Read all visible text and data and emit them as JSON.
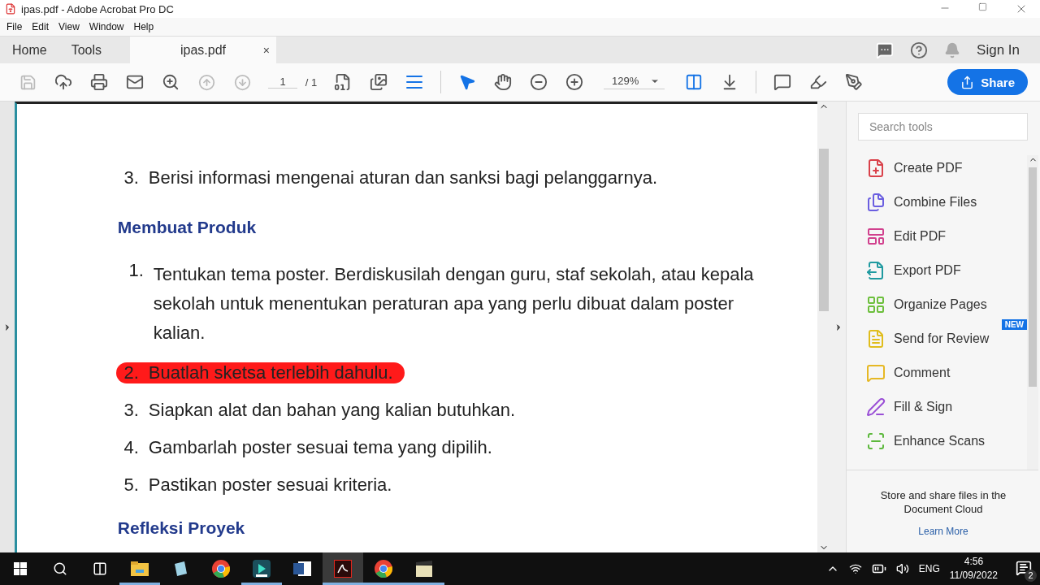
{
  "window": {
    "title": "ipas.pdf - Adobe Acrobat Pro DC"
  },
  "menu": [
    "File",
    "Edit",
    "View",
    "Window",
    "Help"
  ],
  "tabs": [
    {
      "label": "Home",
      "selected": false
    },
    {
      "label": "Tools",
      "selected": false
    },
    {
      "label": "ipas.pdf",
      "selected": true,
      "close": "×"
    }
  ],
  "account": {
    "label": "Sign In"
  },
  "toolbar": {
    "page": "1",
    "page_total": "/ 1",
    "zoom": "129%",
    "share": "Share"
  },
  "document": {
    "lines": [
      {
        "kind": "item",
        "number": "3.",
        "text": "Berisi informasi mengenai aturan dan sanksi bagi pelanggarnya.",
        "highlighted": false
      },
      {
        "kind": "heading",
        "text": "Membuat Produk"
      },
      {
        "kind": "item",
        "number": "1.",
        "text": "Tentukan tema poster. Berdiskusilah dengan guru, staf sekolah, atau kepala sekolah untuk menentukan peraturan apa yang perlu dibuat dalam poster kalian.",
        "highlighted": false
      },
      {
        "kind": "item",
        "number": "2.",
        "text": "Buatlah sketsa terlebih dahulu.",
        "highlighted": true
      },
      {
        "kind": "item",
        "number": "3.",
        "text": "Siapkan alat dan bahan yang kalian butuhkan.",
        "highlighted": false
      },
      {
        "kind": "item",
        "number": "4.",
        "text": "Gambarlah poster sesuai tema yang dipilih.",
        "highlighted": false
      },
      {
        "kind": "item",
        "number": "5.",
        "text": "Pastikan poster sesuai kriteria.",
        "highlighted": false
      },
      {
        "kind": "heading",
        "text": "Refleksi Proyek"
      }
    ]
  },
  "tools_pane": {
    "search": {
      "placeholder": "Search tools"
    },
    "tools": [
      {
        "label": "Create PDF",
        "kind": "create",
        "color": "#d9414a"
      },
      {
        "label": "Combine Files",
        "kind": "combine",
        "color": "#6a5ee0"
      },
      {
        "label": "Edit PDF",
        "kind": "edit",
        "color": "#d1418e"
      },
      {
        "label": "Export PDF",
        "kind": "export",
        "color": "#1f9aa0"
      },
      {
        "label": "Organize Pages",
        "kind": "organize",
        "color": "#6cbf3c"
      },
      {
        "label": "Send for Review",
        "kind": "review",
        "color": "#e0bd1c",
        "badge": "NEW"
      },
      {
        "label": "Comment",
        "kind": "comment",
        "color": "#e6b824"
      },
      {
        "label": "Fill & Sign",
        "kind": "sign",
        "color": "#9a4fd6"
      },
      {
        "label": "Enhance Scans",
        "kind": "scan",
        "color": "#5cb83c"
      }
    ],
    "promo": "Store and share files in the Document Cloud",
    "link": "Learn More"
  },
  "taskbar": {
    "apps": [
      {
        "kind": "explorer",
        "running": true,
        "selected": false
      },
      {
        "kind": "notepad",
        "running": false,
        "selected": false
      },
      {
        "kind": "chrome",
        "running": false,
        "selected": false
      },
      {
        "kind": "editor",
        "running": true,
        "selected": false
      },
      {
        "kind": "word",
        "running": false,
        "selected": false
      },
      {
        "kind": "acrobat",
        "running": true,
        "selected": true
      },
      {
        "kind": "chrome",
        "running": true,
        "selected": false
      },
      {
        "kind": "media",
        "running": true,
        "selected": false
      }
    ],
    "language": "ENG",
    "time": "4:56",
    "date": "11/09/2022",
    "notifications": "2"
  }
}
